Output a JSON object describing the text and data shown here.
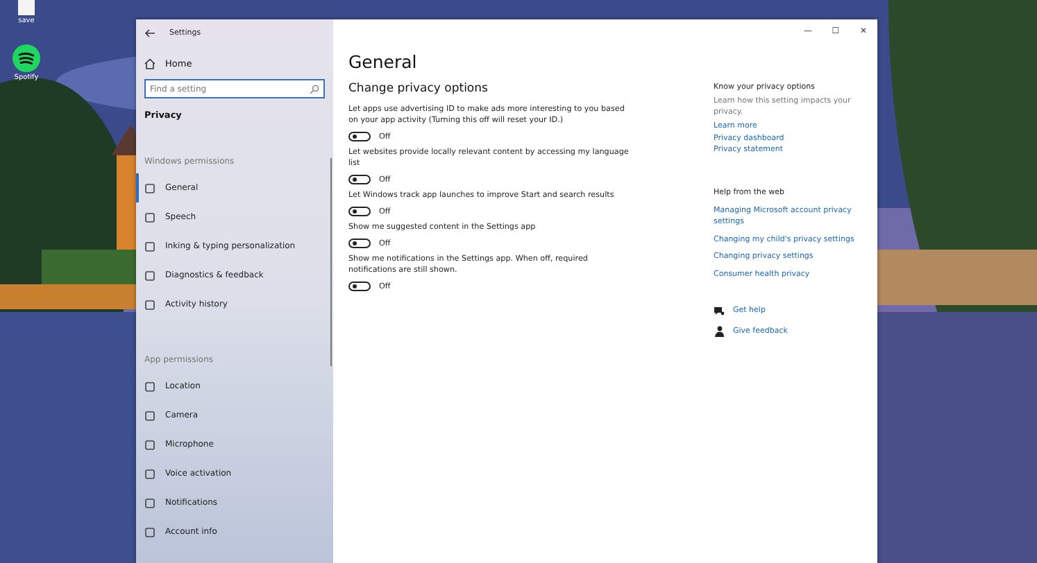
{
  "desktop_icons": [
    {
      "kind": "file",
      "label": "save"
    },
    {
      "kind": "app",
      "label": "Spotify"
    }
  ],
  "window": {
    "title": "Settings",
    "controls": [
      "—",
      "☐",
      "✕"
    ]
  },
  "sidebar": {
    "home": "Home",
    "search": {
      "placeholder": "Find a setting"
    },
    "section_title": "Privacy",
    "groups": [
      {
        "heading": "Windows permissions",
        "items": [
          {
            "label": "General",
            "selected": true
          },
          {
            "label": "Speech",
            "selected": false
          },
          {
            "label": "Inking & typing personalization",
            "selected": false
          },
          {
            "label": "Diagnostics & feedback",
            "selected": false
          },
          {
            "label": "Activity history",
            "selected": false
          }
        ]
      },
      {
        "heading": "App permissions",
        "items": [
          {
            "label": "Location",
            "selected": false
          },
          {
            "label": "Camera",
            "selected": false
          },
          {
            "label": "Microphone",
            "selected": false
          },
          {
            "label": "Voice activation",
            "selected": false
          },
          {
            "label": "Notifications",
            "selected": false
          },
          {
            "label": "Account info",
            "selected": false
          }
        ]
      }
    ]
  },
  "content": {
    "title": "General",
    "subtitle": "Change privacy options",
    "options": [
      {
        "description": "Let apps use advertising ID to make ads more interesting to you based on your app activity (Turning this off will reset your ID.)",
        "on": false,
        "state": "Off"
      },
      {
        "description": "Let websites provide locally relevant content by accessing my language list",
        "on": false,
        "state": "Off"
      },
      {
        "description": "Let Windows track app launches to improve Start and search results",
        "on": false,
        "state": "Off"
      },
      {
        "description": "Show me suggested content in the Settings app",
        "on": false,
        "state": "Off"
      },
      {
        "description": "Show me notifications in the Settings app. When off, required notifications are still shown.",
        "on": false,
        "state": "Off"
      }
    ]
  },
  "aside": {
    "privacy_heading": "Know your privacy options",
    "privacy_text": "Learn how this setting impacts your privacy.",
    "privacy_links": [
      "Learn more",
      "Privacy dashboard",
      "Privacy statement"
    ],
    "web_heading": "Help from the web",
    "web_links": [
      "Managing Microsoft account privacy settings",
      "Changing my child's privacy settings",
      "Changing privacy settings",
      "Consumer health privacy"
    ],
    "actions": [
      {
        "kind": "help",
        "label": "Get help"
      },
      {
        "kind": "feedback",
        "label": "Give feedback"
      }
    ]
  }
}
